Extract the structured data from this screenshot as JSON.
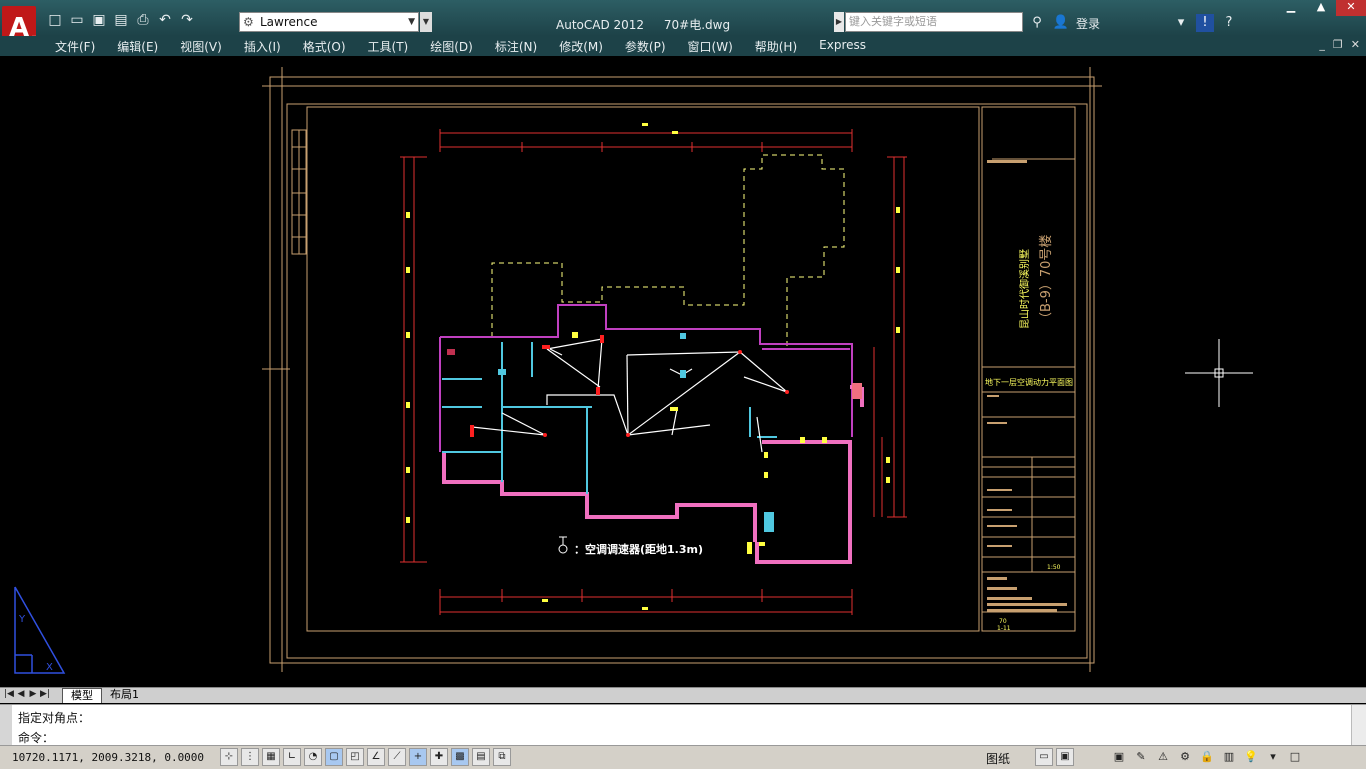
{
  "titlebar": {
    "workspace": "Lawrence",
    "app_name": "AutoCAD 2012",
    "file_name": "70#电.dwg",
    "search_placeholder": "键入关键字或短语",
    "login_label": "登录"
  },
  "menu": {
    "items": [
      "文件(F)",
      "编辑(E)",
      "视图(V)",
      "插入(I)",
      "格式(O)",
      "工具(T)",
      "绘图(D)",
      "标注(N)",
      "修改(M)",
      "参数(P)",
      "窗口(W)",
      "帮助(H)",
      "Express"
    ]
  },
  "drawing": {
    "legend_text": "：空调调速器(距地1.3m)",
    "title_project": "昆山时代御溪别墅",
    "title_building": "（B-9）70号楼",
    "sheet_title": "地下一层空调动力平面图",
    "sheet_no": "70",
    "sheet_sub": "1-11",
    "scale": "1:50",
    "colors": {
      "frame": "#c8a070",
      "dim": "#e03030",
      "wall_outer": "#c040c0",
      "wall_pink": "#f070c0",
      "wall_cyan": "#50c8e0",
      "wire": "#ffffff",
      "device": "#ffff40",
      "dashed": "#ffff80"
    }
  },
  "tabs": {
    "model": "模型",
    "layout": "布局1"
  },
  "command": {
    "history": "指定对角点：",
    "prompt": "命令："
  },
  "status": {
    "coordinates": "10720.1171,  2009.3218,  0.0000",
    "paper_label": "图纸"
  }
}
